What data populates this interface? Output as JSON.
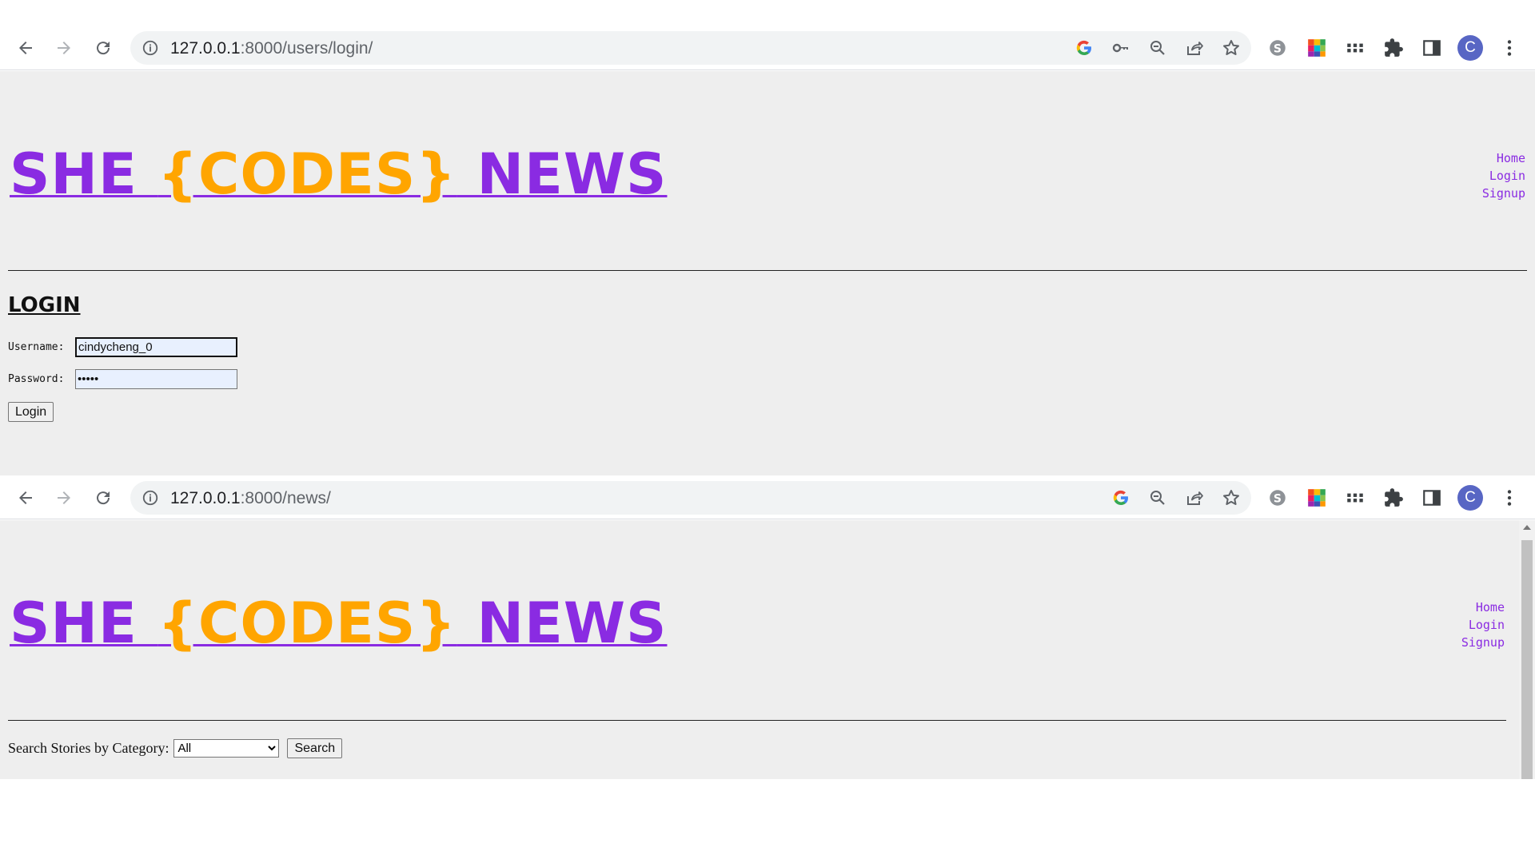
{
  "browser1": {
    "url_host": "127.0.0.1",
    "url_path": ":8000/users/login/",
    "avatar_letter": "C"
  },
  "browser2": {
    "url_host": "127.0.0.1",
    "url_path": ":8000/news/",
    "avatar_letter": "C"
  },
  "site": {
    "brand_she": "SHE ",
    "brand_codes": "{CODES}",
    "brand_news": " NEWS",
    "colors": {
      "purple": "#8a2be2",
      "orange": "#ffa500",
      "background": "#eeeeee"
    },
    "nav": [
      "Home",
      "Login",
      "Signup"
    ]
  },
  "login_page": {
    "title": "LOGIN",
    "username_label": "Username:",
    "username_value": "cindycheng_0",
    "password_label": "Password:",
    "password_value": "•••••",
    "submit_label": "Login"
  },
  "news_page": {
    "search_label": "Search Stories by Category:",
    "category_selected": "All",
    "search_button": "Search"
  },
  "icons": [
    "back-icon",
    "forward-icon",
    "reload-icon",
    "info-icon",
    "google-icon",
    "key-icon",
    "zoom-out-icon",
    "share-icon",
    "star-icon",
    "skype-icon",
    "color-grid-icon",
    "apps-icon",
    "puzzle-icon",
    "side-panel-icon",
    "more-icon"
  ]
}
